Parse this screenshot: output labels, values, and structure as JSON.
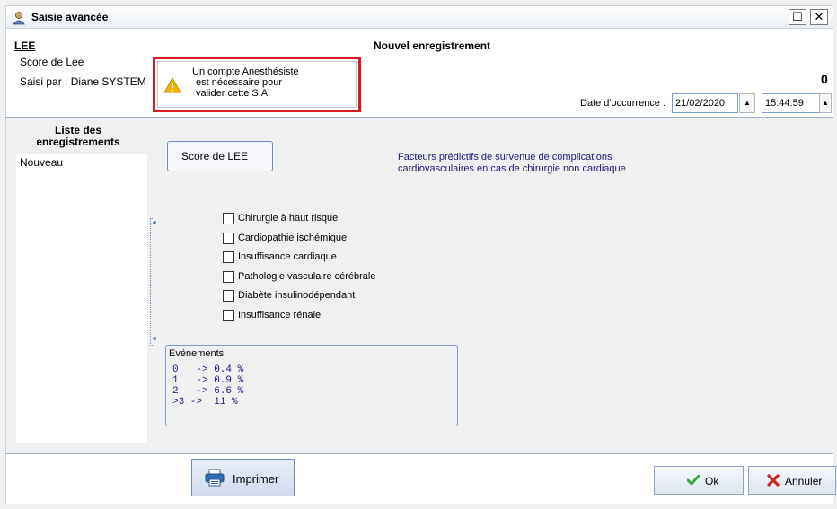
{
  "window": {
    "title": "Saisie avancée",
    "buttons": {
      "maximize": "☐",
      "close": "✕"
    }
  },
  "header": {
    "code": "LEE",
    "name": "Score de Lee",
    "saisi_par": "Saisi par  : Diane SYSTEM",
    "title": "Nouvel enregistrement",
    "score": "0"
  },
  "warning": {
    "line1": "Un compte Anesthésiste",
    "line2": "est nécessaire pour",
    "line3": "valider cette S.A.",
    "icon": "warning-icon",
    "border_color": "#d71920"
  },
  "occurrence": {
    "label": "Date d'occurrence :",
    "date": "21/02/2020",
    "time": "15:44:59"
  },
  "list": {
    "title_line1": "Liste des",
    "title_line2": "enregistrements",
    "items": [
      "Nouveau"
    ]
  },
  "form": {
    "score_button": "Score de LEE",
    "description_line1": "Facteurs prédictifs de survenue de complications",
    "description_line2": "cardiovasculaires en cas de chirurgie non cardiaque",
    "criteria": [
      {
        "label": "Chirurgie à haut risque",
        "checked": false
      },
      {
        "label": "Cardiopathie ischémique",
        "checked": false
      },
      {
        "label": "Insuffisance cardiaque",
        "checked": false
      },
      {
        "label": "Pathologie vasculaire cérébrale",
        "checked": false
      },
      {
        "label": "Diabète insulinodépendant",
        "checked": false
      },
      {
        "label": "Insuffisance rénale",
        "checked": false
      }
    ],
    "events_title": "Evénements",
    "events": [
      "0   -> 0.4 %",
      "1   -> 0.9 %",
      "2   -> 6.6 %",
      ">3 ->  11 %"
    ]
  },
  "footer": {
    "print": "Imprimer",
    "ok": "Ok",
    "cancel": "Annuler"
  },
  "colors": {
    "accent": "#6c8ac0",
    "text_blue": "#1a1a7a",
    "ok_green": "#3aa83a",
    "cancel_red": "#d32020"
  }
}
